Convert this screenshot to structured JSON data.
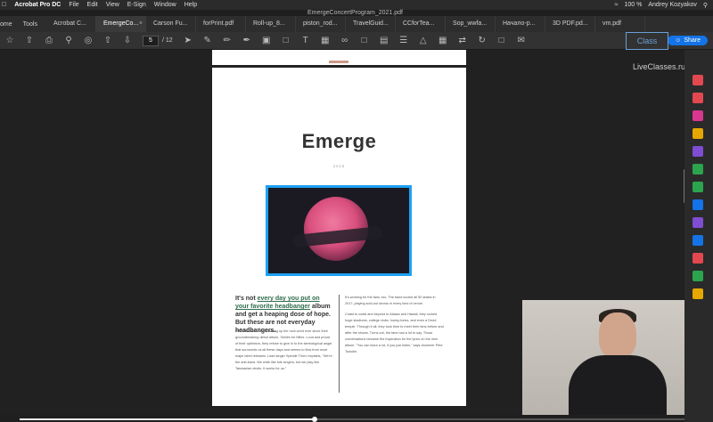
{
  "menubar": {
    "app": "Acrobat Pro DC",
    "items": [
      "File",
      "Edit",
      "View",
      "E-Sign",
      "Window",
      "Help"
    ],
    "battery": "100 %",
    "time": "Andrey Kozyakov"
  },
  "doc_title": "EmergeConcertProgram_2021.pdf",
  "tabs": {
    "home": "ome",
    "tools": "Tools",
    "items": [
      {
        "label": "Acrobat C..."
      },
      {
        "label": "EmergeCo..."
      },
      {
        "label": "Carson Fu..."
      },
      {
        "label": "forPrint.pdf"
      },
      {
        "label": "Roll-up_8..."
      },
      {
        "label": "piston_rod..."
      },
      {
        "label": "TravelGuid..."
      },
      {
        "label": "CCforTea..."
      },
      {
        "label": "Sop_wwfa..."
      },
      {
        "label": "Начало-р..."
      },
      {
        "label": "3D PDF.pd..."
      },
      {
        "label": "vm.pdf"
      }
    ]
  },
  "toolbar": {
    "page_current": "5",
    "page_total": "/ 12",
    "share_label": "Share"
  },
  "watermark": "LiveClasses.ru",
  "logo": "Class",
  "page": {
    "title": "Emerge",
    "year": "2015",
    "lead_1": "It's not ",
    "lead_link": "every day you put on your favorite headbanger",
    "lead_2": " album and get a heaping dose of hope. But these are not everyday headbangers.",
    "col1": "Primordial has been shaking up the rock word ever since their groundbreaking debut album, Smiles for Miles. Loud and proud of their optimism, they refuse to give in to the stereotypical angst that surrounds us all these days and seems to flow from most major label releases. Lead singer Spindle Thorn explains, \"We're the anti-band. We write like folk singers, but we play like Tasmanian devils. It works for us.\"",
    "col2_p1": "It's working for the fans, too. The band toured all 50 states in 2017, playing sold-out shows in every kind of venue.",
    "col2_p2": "Coast to coast and beyond to Alaska and Hawaii, they rocked huge stadiums, college clubs, honky-tonks, and even a Druid temple. Through it all, they took time to meet their fans before and after the shows. Turns out, the fans had a lot to say. Those conversations became the inspiration for the lyrics on the new album. \"You can learn a lot, if you just listen,\" says drummer Pete Tousdin."
  },
  "video_progress": 0.44
}
